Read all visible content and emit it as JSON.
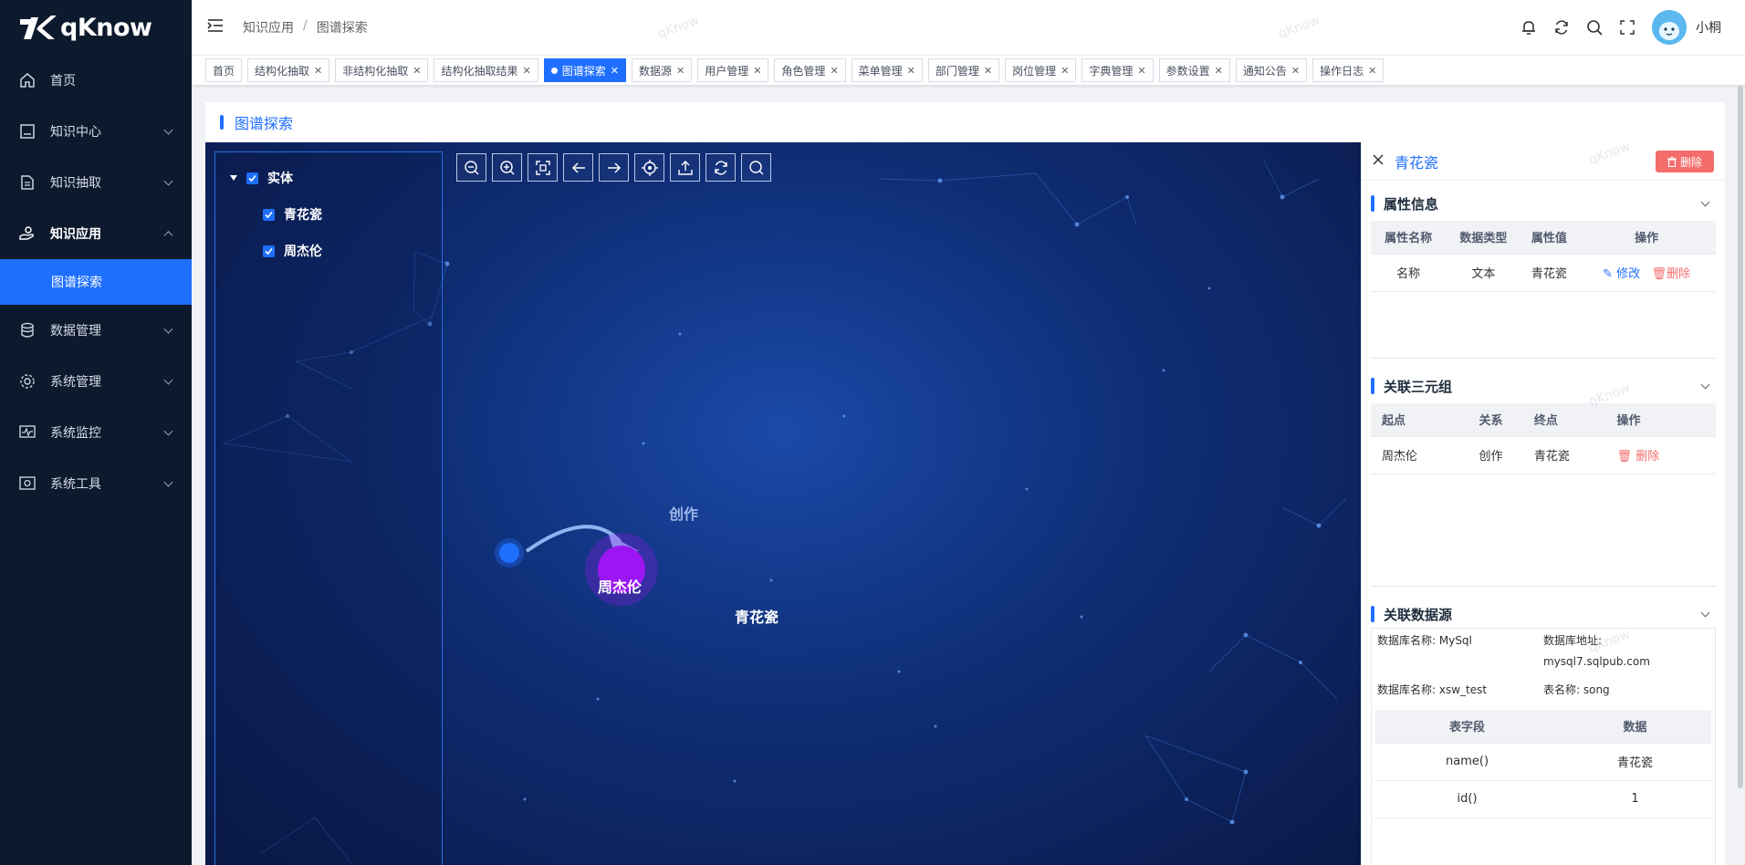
{
  "app": {
    "logo_text": "qKnow"
  },
  "sidebar": {
    "items": [
      {
        "label": "首页",
        "icon": "home-icon"
      },
      {
        "label": "知识中心",
        "icon": "book-icon"
      },
      {
        "label": "知识抽取",
        "icon": "document-icon"
      },
      {
        "label": "知识应用",
        "icon": "hand-icon",
        "submenu": [
          {
            "label": "图谱探索"
          }
        ]
      },
      {
        "label": "数据管理",
        "icon": "database-icon"
      },
      {
        "label": "系统管理",
        "icon": "gear-icon"
      },
      {
        "label": "系统监控",
        "icon": "monitor-icon"
      },
      {
        "label": "系统工具",
        "icon": "tool-icon"
      }
    ]
  },
  "header": {
    "breadcrumb": [
      "知识应用",
      "图谱探索"
    ],
    "breadcrumb_sep": "/",
    "username": "小桐"
  },
  "tags": [
    {
      "label": "首页",
      "closable": false
    },
    {
      "label": "结构化抽取",
      "closable": true
    },
    {
      "label": "非结构化抽取",
      "closable": true
    },
    {
      "label": "结构化抽取结果",
      "closable": true
    },
    {
      "label": "图谱探索",
      "closable": true,
      "active": true
    },
    {
      "label": "数据源",
      "closable": true
    },
    {
      "label": "用户管理",
      "closable": true
    },
    {
      "label": "角色管理",
      "closable": true
    },
    {
      "label": "菜单管理",
      "closable": true
    },
    {
      "label": "部门管理",
      "closable": true
    },
    {
      "label": "岗位管理",
      "closable": true
    },
    {
      "label": "字典管理",
      "closable": true
    },
    {
      "label": "参数设置",
      "closable": true
    },
    {
      "label": "通知公告",
      "closable": true
    },
    {
      "label": "操作日志",
      "closable": true
    }
  ],
  "page": {
    "title": "图谱探索"
  },
  "tree": {
    "root": "实体",
    "children": [
      "青花瓷",
      "周杰伦"
    ]
  },
  "graph": {
    "nodes": [
      {
        "label": "周杰伦",
        "color": "#1f6fff"
      },
      {
        "label": "青花瓷",
        "color": "#9b16f2"
      }
    ],
    "edge_label": "创作"
  },
  "detail": {
    "title": "青花瓷",
    "delete_label": "删除",
    "attr_section": {
      "title": "属性信息",
      "headers": [
        "属性名称",
        "数据类型",
        "属性值",
        "操作"
      ],
      "rows": [
        {
          "name": "名称",
          "type": "文本",
          "value": "青花瓷",
          "edit": "修改",
          "del": "删除"
        }
      ]
    },
    "triple_section": {
      "title": "关联三元组",
      "headers": [
        "起点",
        "关系",
        "终点",
        "操作"
      ],
      "rows": [
        {
          "start": "周杰伦",
          "rel": "创作",
          "end": "青花瓷",
          "del": "删除"
        }
      ]
    },
    "ds_section": {
      "title": "关联数据源",
      "db_name_1": "数据库名称: MySql",
      "db_addr_label": "数据库地址:",
      "db_addr": "mysql7.sqlpub.com",
      "db_name_2": "数据库名称: xsw_test",
      "table_name": "表名称: song",
      "headers": [
        "表字段",
        "数据"
      ],
      "rows": [
        {
          "field": "name()",
          "value": "青花瓷"
        },
        {
          "field": "id()",
          "value": "1"
        }
      ]
    }
  },
  "watermark": "qKnow",
  "colors": {
    "primary": "#1f6fff",
    "danger": "#f56c6c",
    "sidebar_bg": "#0d1a2e"
  }
}
